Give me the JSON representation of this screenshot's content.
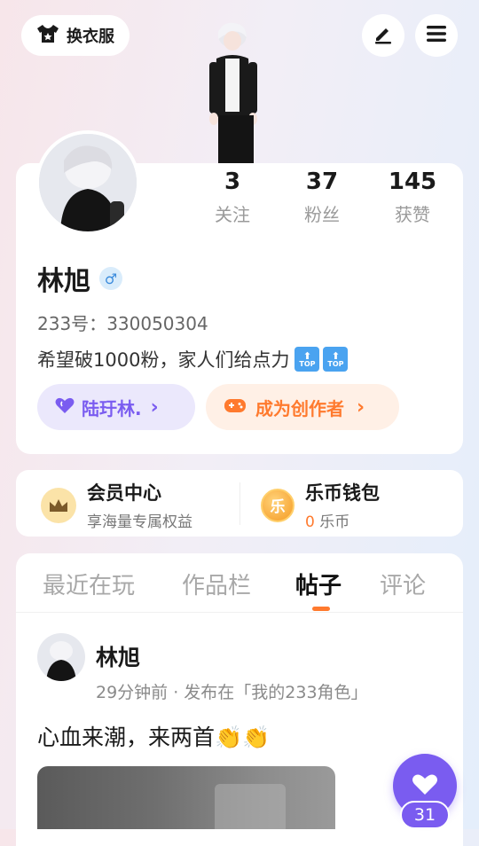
{
  "top": {
    "outfit_label": "换衣服",
    "icons": [
      "edit-icon",
      "menu-icon"
    ]
  },
  "profile": {
    "stats": [
      {
        "value": "3",
        "label": "关注"
      },
      {
        "value": "37",
        "label": "粉丝"
      },
      {
        "value": "145",
        "label": "获赞"
      }
    ],
    "name": "林旭",
    "gender_symbol": "♂",
    "id_label": "233号：",
    "id_value": "330050304",
    "bio_text": "希望破1000粉，家人们给点力",
    "bio_badges": [
      "TOP",
      "TOP"
    ],
    "tags": [
      {
        "label": "陆玗林.",
        "arrow": "›"
      },
      {
        "label": "成为创作者",
        "arrow": "›"
      }
    ]
  },
  "cards": {
    "member": {
      "title": "会员中心",
      "subtitle": "享海量专属权益"
    },
    "wallet": {
      "title": "乐币钱包",
      "coin_glyph": "乐",
      "amount": "0",
      "unit": "乐币"
    }
  },
  "tabs": [
    {
      "label": "最近在玩",
      "active": false
    },
    {
      "label": "作品栏",
      "active": false
    },
    {
      "label": "帖子",
      "active": true
    },
    {
      "label": "评论",
      "active": false
    }
  ],
  "post": {
    "author": "林旭",
    "meta": "29分钟前 · 发布在「我的233角色」",
    "content": "心血来潮，来两首",
    "emoji": "👏👏"
  },
  "fab": {
    "count": "31"
  },
  "colors": {
    "purple": "#7a5cf0",
    "orange": "#ff7a2e",
    "purple_bg": "#ebe8fc",
    "orange_bg": "#fff0e6"
  }
}
